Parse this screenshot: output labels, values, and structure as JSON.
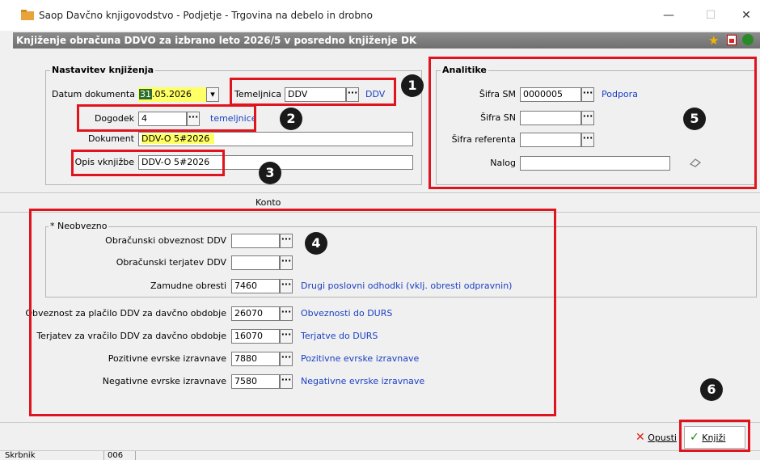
{
  "window": {
    "title": "Saop Davčno knjigovodstvo - Podjetje - Trgovina na debelo in drobno",
    "minimize": "—",
    "maximize": "☐",
    "close": "✕"
  },
  "header": {
    "title": "Knjiženje obračuna DDVO za izbrano leto 2026/5 v posredno knjiženje DK",
    "icons": [
      "star-icon",
      "document-close-icon",
      "exit-icon"
    ]
  },
  "nastavitev": {
    "legend": "Nastavitev knjiženja",
    "datum_label": "Datum dokumenta",
    "datum_day": "31",
    "datum_rest": ".05.2026",
    "temeljnica_label": "Temeljnica",
    "temeljnica_value": "DDV",
    "temeljnica_link": "DDV",
    "dogodek_label": "Dogodek",
    "dogodek_value": "4",
    "dogodek_link": "temeljnice",
    "dokument_label": "Dokument",
    "dokument_value": "DDV-O 5#2026",
    "opis_label": "Opis vknjižbe",
    "opis_value": "DDV-O 5#2026"
  },
  "analitike": {
    "legend": "Analitike",
    "sifra_sm_label": "Šifra SM",
    "sifra_sm_value": "0000005",
    "sifra_sm_link": "Podpora",
    "sifra_sn_label": "Šifra SN",
    "sifra_sn_value": "",
    "sifra_referenta_label": "Šifra referenta",
    "sifra_referenta_value": "",
    "nalog_label": "Nalog",
    "nalog_value": ""
  },
  "konto": {
    "section_label": "Konto",
    "neobvezno_legend": "* Neobvezno",
    "rows_optional": [
      {
        "label": "Obračunski obveznost DDV",
        "value": "",
        "link": ""
      },
      {
        "label": "Obračunski terjatev DDV",
        "value": "",
        "link": ""
      },
      {
        "label": "Zamudne obresti",
        "value": "7460",
        "link": "Drugi poslovni odhodki (vklj. obresti odpravnin)"
      }
    ],
    "rows": [
      {
        "label": "Obveznost za plačilo DDV za davčno obdobje",
        "value": "26070",
        "link": "Obveznosti do DURS"
      },
      {
        "label": "Terjatev za vračilo DDV za davčno obdobje",
        "value": "16070",
        "link": "Terjatve do DURS"
      },
      {
        "label": "Pozitivne evrske izravnave",
        "value": "7880",
        "link": "Pozitivne evrske izravnave"
      },
      {
        "label": "Negativne evrske izravnave",
        "value": "7580",
        "link": "Negativne evrske izravnave"
      }
    ]
  },
  "buttons": {
    "cancel_label": "Opusti",
    "book_label": "Knjiži"
  },
  "statusbar": {
    "user": "Skrbnik",
    "code": "006"
  },
  "annotations": [
    "1",
    "2",
    "3",
    "4",
    "5",
    "6"
  ],
  "colors": {
    "accent_red": "#e0141e",
    "link_blue": "#1a3fc4",
    "highlight_yellow": "#ffff66"
  }
}
